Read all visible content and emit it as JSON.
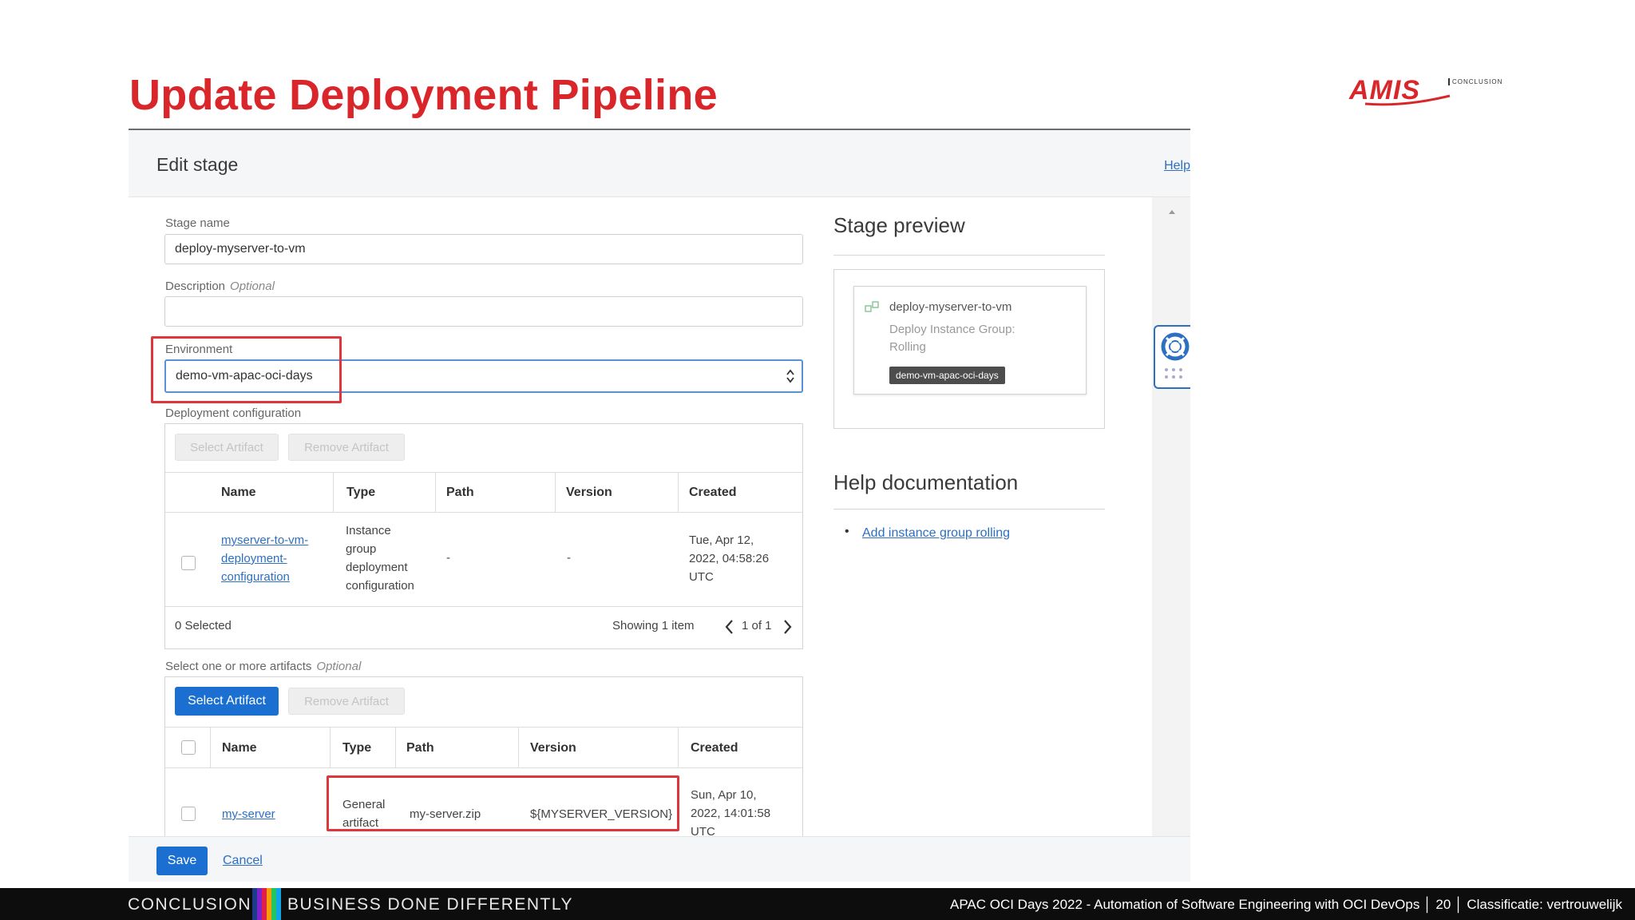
{
  "slide": {
    "title": "Update Deployment Pipeline",
    "logo": {
      "word": "AMIS",
      "tagline": "CONCLUSION"
    }
  },
  "dialog": {
    "title": "Edit stage",
    "help_link": "Help",
    "stage_name": {
      "label": "Stage name",
      "value": "deploy-myserver-to-vm"
    },
    "description": {
      "label": "Description",
      "optional": "Optional",
      "value": ""
    },
    "environment": {
      "label": "Environment",
      "value": "demo-vm-apac-oci-days"
    },
    "deployment_config": {
      "label": "Deployment configuration",
      "select_button": "Select Artifact",
      "remove_button": "Remove Artifact",
      "columns": [
        "Name",
        "Type",
        "Path",
        "Version",
        "Created"
      ],
      "rows": [
        {
          "name": [
            "myserver-to-vm-",
            "deployment-",
            "configuration"
          ],
          "type": [
            "Instance",
            "group",
            "deployment",
            "configuration"
          ],
          "path": "-",
          "version": "-",
          "created": [
            "Tue, Apr 12,",
            "2022, 04:58:26",
            "UTC"
          ]
        }
      ],
      "selected": "0 Selected",
      "showing": "Showing 1 item",
      "page": "1 of 1"
    },
    "artifacts": {
      "label": "Select one or more artifacts",
      "optional": "Optional",
      "select_button": "Select Artifact",
      "remove_button": "Remove Artifact",
      "columns": [
        "Name",
        "Type",
        "Path",
        "Version",
        "Created"
      ],
      "rows": [
        {
          "name": "my-server",
          "type": [
            "General",
            "artifact"
          ],
          "path": "my-server.zip",
          "version": "${MYSERVER_VERSION}",
          "created": [
            "Sun, Apr 10,",
            "2022, 14:01:58",
            "UTC"
          ]
        }
      ]
    },
    "save_button": "Save",
    "cancel_link": "Cancel",
    "preview": {
      "title": "Stage preview",
      "stage_name": "deploy-myserver-to-vm",
      "line1": "Deploy Instance Group:",
      "line2": "Rolling",
      "badge": "demo-vm-apac-oci-days"
    },
    "help_doc": {
      "title": "Help documentation",
      "link": "Add instance group rolling"
    }
  },
  "footer": {
    "left1": "CONCLUSION",
    "left2": "BUSINESS DONE DIFFERENTLY",
    "right": "APAC OCI Days 2022 - Automation of Software Engineering with OCI DevOps │  20 │ Classificatie: vertrouwelijk"
  },
  "colors": {
    "accent_red": "#d9262a",
    "link_blue": "#2d6fc1",
    "primary_button": "#1a6fd1",
    "highlight_box": "#e0353a"
  }
}
